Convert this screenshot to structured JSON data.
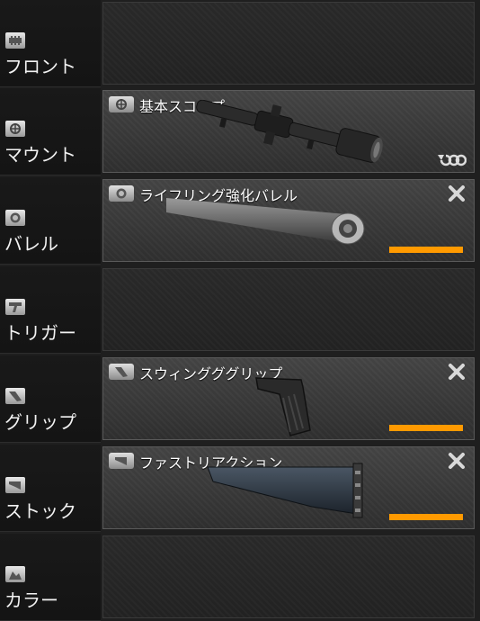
{
  "colors": {
    "durability": "#ff9a00",
    "slot_filled": "#3b3b3b",
    "slot_empty": "#262626",
    "label_bg": "#171717"
  },
  "rows": [
    {
      "id": "front",
      "label": "フロント",
      "icon": "front-rail-icon"
    },
    {
      "id": "mount",
      "label": "マウント",
      "icon": "crosshair-icon",
      "part": {
        "name": "基本スコープ",
        "icon": "crosshair-icon",
        "image": "rifle-scope-image",
        "action_icon": "loop-icon"
      }
    },
    {
      "id": "barrel",
      "label": "バレル",
      "icon": "barrel-ring-icon",
      "part": {
        "name": "ライフリング強化バレル",
        "icon": "barrel-ring-icon",
        "image": "barrel-image",
        "remove_icon": "close-icon",
        "durability": 1.0
      }
    },
    {
      "id": "trigger",
      "label": "トリガー",
      "icon": "trigger-icon"
    },
    {
      "id": "grip",
      "label": "グリップ",
      "icon": "grip-icon",
      "part": {
        "name": "スウィングググリップ",
        "icon": "grip-icon",
        "image": "pistol-grip-image",
        "remove_icon": "close-icon",
        "durability": 1.0
      }
    },
    {
      "id": "stock",
      "label": "ストック",
      "icon": "stock-icon",
      "part": {
        "name": "ファストリアクション",
        "icon": "stock-icon",
        "image": "rifle-stock-image",
        "remove_icon": "close-icon",
        "durability": 1.0
      }
    },
    {
      "id": "color",
      "label": "カラー",
      "icon": "color-icon"
    }
  ]
}
